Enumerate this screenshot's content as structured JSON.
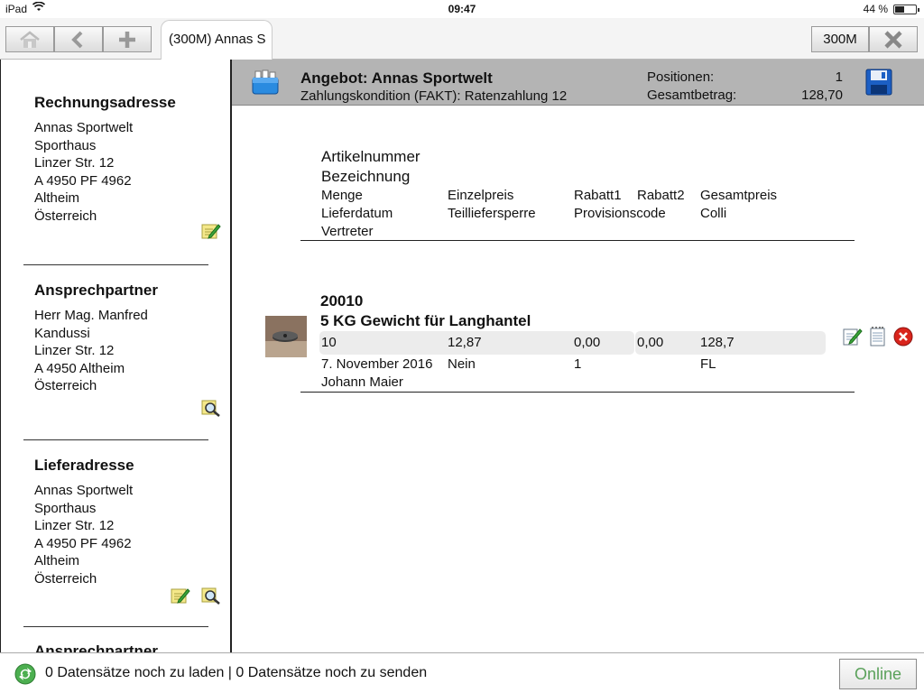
{
  "status_bar": {
    "device": "iPad",
    "time": "09:47",
    "battery": "44 %",
    "battery_level": 0.44
  },
  "toolbar": {
    "tab_label": "(300M) Annas S",
    "company_button": "300M"
  },
  "left": {
    "billing": {
      "heading": "Rechnungsadresse",
      "lines": [
        "Annas Sportwelt",
        "Sporthaus",
        "Linzer Str. 12",
        "A 4950 PF 4962",
        "Altheim",
        "Österreich"
      ]
    },
    "contact": {
      "heading": "Ansprechpartner",
      "lines": [
        "Herr Mag. Manfred",
        "Kandussi",
        "Linzer Str. 12",
        "A 4950 Altheim",
        "Österreich"
      ]
    },
    "delivery": {
      "heading": "Lieferadresse",
      "lines": [
        "Annas Sportwelt",
        "Sporthaus",
        "Linzer Str. 12",
        "A 4950 PF 4962",
        "Altheim",
        "Österreich"
      ]
    },
    "contact2": {
      "heading": "Ansprechpartner"
    }
  },
  "header": {
    "title": "Angebot: Annas Sportwelt",
    "subtitle": "Zahlungskondition (FAKT): Ratenzahlung 12",
    "positions_label": "Positionen:",
    "positions_value": "1",
    "total_label": "Gesamtbetrag:",
    "total_value": "128,70"
  },
  "columns": {
    "article_no": "Artikelnummer",
    "description": "Bezeichnung",
    "quantity": "Menge",
    "unit_price": "Einzelpreis",
    "discount1": "Rabatt1",
    "discount2": "Rabatt2",
    "total_price": "Gesamtpreis",
    "delivery_date": "Lieferdatum",
    "partial_block": "Teilliefersperre",
    "commission": "Provisionscode",
    "colli": "Colli",
    "rep": "Vertreter"
  },
  "item": {
    "article_no": "20010",
    "description": "5 KG Gewicht für Langhantel",
    "quantity": "10",
    "unit_price": "12,87",
    "discount1": "0,00",
    "discount2": "0,00",
    "total_price": "128,7",
    "delivery_date": "7. November 2016",
    "partial_block": "Nein",
    "commission": "1",
    "colli": "FL",
    "rep": "Johann Maier"
  },
  "footer": {
    "sync_message": "0 Datensätze noch zu laden | 0 Datensätze noch zu senden",
    "online_button": "Online"
  },
  "colors": {
    "header_bg": "#b4b4b4",
    "online_text": "#5aa15a",
    "delete_red": "#d9241c",
    "save_blue": "#1c5fc4"
  }
}
